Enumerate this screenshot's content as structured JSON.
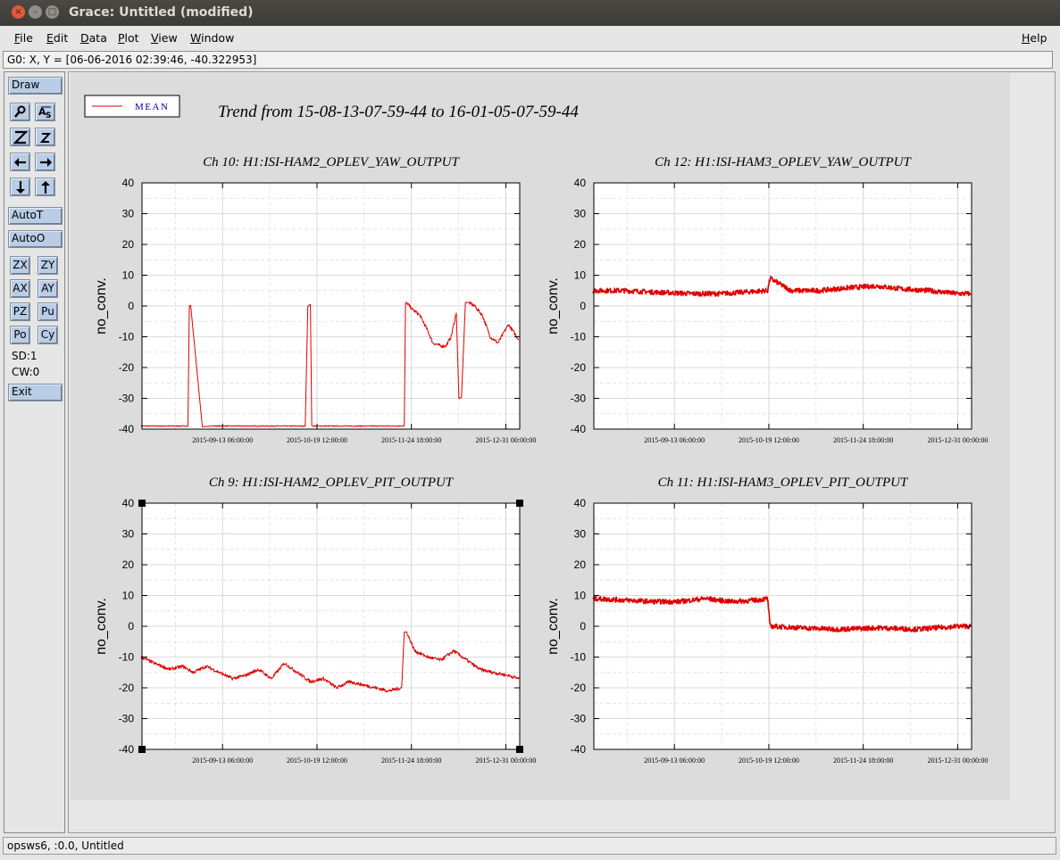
{
  "window": {
    "title": "Grace: Untitled (modified)",
    "controls": [
      "×",
      "–",
      "□"
    ]
  },
  "menubar": {
    "items": [
      {
        "label": "File",
        "mnemonic": "F",
        "rest": "ile"
      },
      {
        "label": "Edit",
        "mnemonic": "E",
        "rest": "dit"
      },
      {
        "label": "Data",
        "mnemonic": "D",
        "rest": "ata"
      },
      {
        "label": "Plot",
        "mnemonic": "P",
        "rest": "lot"
      },
      {
        "label": "View",
        "mnemonic": "V",
        "rest": "iew"
      },
      {
        "label": "Window",
        "mnemonic": "W",
        "rest": "indow"
      }
    ],
    "help": {
      "label": "Help",
      "mnemonic": "H",
      "rest": "elp"
    }
  },
  "coord_readout": "G0: X, Y = [06-06-2016 02:39:46, -40.322953]",
  "toolpanel": {
    "draw": "Draw",
    "icon_buttons": [
      {
        "name": "zoom-magnifier-icon",
        "label": ""
      },
      {
        "name": "autoscale-text-icon",
        "label": ""
      },
      {
        "name": "zoom-in-z-icon",
        "label": ""
      },
      {
        "name": "zoom-out-z-icon",
        "label": ""
      },
      {
        "name": "arrow-left-icon",
        "label": ""
      },
      {
        "name": "arrow-right-icon",
        "label": ""
      },
      {
        "name": "arrow-down-icon",
        "label": ""
      },
      {
        "name": "arrow-up-icon",
        "label": ""
      }
    ],
    "autot": "AutoT",
    "autoo": "AutoO",
    "small_buttons": [
      "ZX",
      "ZY",
      "AX",
      "AY",
      "PZ",
      "Pu",
      "Po",
      "Cy"
    ],
    "sd": "SD:1",
    "cw": "CW:0",
    "exit": "Exit"
  },
  "status_text": "opsws6, :0.0, Untitled",
  "colors": {
    "series": "#e00000",
    "legend_text": "#0000aa",
    "button_face": "#b9cde6"
  },
  "figure": {
    "title": "Trend from 15-08-13-07-59-44 to 16-01-05-07-59-44",
    "legend": {
      "label": "MEAN",
      "placement": "top-left"
    }
  },
  "chart_data": [
    {
      "type": "line",
      "title": "Ch 10: H1:ISI-HAM2_OPLEV_YAW_OUTPUT",
      "ylabel": "no_conv.",
      "xlabel": "",
      "ylim": [
        -40,
        40
      ],
      "xlim": [
        "2015-08-13 07:59:44",
        "2016-01-05 07:59:44"
      ],
      "yticks": [
        -40,
        -30,
        -20,
        -10,
        0,
        10,
        20,
        30,
        40
      ],
      "xticks": [
        "2015-09-13 06:00:00",
        "2015-10-19 12:00:00",
        "2015-11-24 18:00:00",
        "2015-12-31 00:00:00"
      ],
      "grid": true,
      "series": [
        {
          "name": "MEAN",
          "x": [
            "2015-08-13",
            "2015-08-20",
            "2015-08-27",
            "2015-08-31",
            "2015-09-01",
            "2015-09-10",
            "2015-09-20",
            "2015-10-01",
            "2015-10-15",
            "2015-10-17",
            "2015-10-18",
            "2015-10-25",
            "2015-11-10",
            "2015-11-22",
            "2015-11-23",
            "2015-11-25",
            "2015-11-28",
            "2015-12-01",
            "2015-12-03",
            "2015-12-06",
            "2015-12-08",
            "2015-12-10",
            "2015-12-12",
            "2015-12-14",
            "2015-12-17",
            "2015-12-19",
            "2015-12-22",
            "2015-12-25",
            "2015-12-28",
            "2016-01-01",
            "2016-01-05"
          ],
          "values": [
            -39,
            -39,
            -39,
            -39,
            0,
            -39,
            -39,
            -39,
            -39,
            0,
            -39,
            -39,
            -39,
            -39,
            1,
            -1,
            -3,
            -8,
            -12,
            -13,
            -13,
            -10,
            -2,
            -30,
            1,
            0,
            -3,
            -10,
            -12,
            -6,
            -11
          ]
        }
      ]
    },
    {
      "type": "line",
      "title": "Ch 12: H1:ISI-HAM3_OPLEV_YAW_OUTPUT",
      "ylabel": "no_conv.",
      "xlabel": "",
      "ylim": [
        -40,
        40
      ],
      "xlim": [
        "2015-08-13 07:59:44",
        "2016-01-05 07:59:44"
      ],
      "yticks": [
        -40,
        -30,
        -20,
        -10,
        0,
        10,
        20,
        30,
        40
      ],
      "xticks": [
        "2015-09-13 06:00:00",
        "2015-10-19 12:00:00",
        "2015-11-24 18:00:00",
        "2015-12-31 00:00:00"
      ],
      "grid": true,
      "series": [
        {
          "name": "MEAN",
          "x": [
            "2015-08-13",
            "2015-08-25",
            "2015-09-05",
            "2015-09-20",
            "2015-10-01",
            "2015-10-10",
            "2015-10-19",
            "2015-10-20",
            "2015-10-28",
            "2015-11-08",
            "2015-11-20",
            "2015-11-30",
            "2015-12-10",
            "2015-12-20",
            "2015-12-31",
            "2016-01-05"
          ],
          "values": [
            5,
            5,
            4.5,
            4,
            4,
            4.5,
            5,
            9,
            5,
            5,
            6,
            6.5,
            5.5,
            5,
            4,
            4
          ]
        }
      ]
    },
    {
      "type": "line",
      "title": "Ch 9: H1:ISI-HAM2_OPLEV_PIT_OUTPUT",
      "ylabel": "no_conv.",
      "xlabel": "",
      "ylim": [
        -40,
        40
      ],
      "xlim": [
        "2015-08-13 07:59:44",
        "2016-01-05 07:59:44"
      ],
      "yticks": [
        -40,
        -30,
        -20,
        -10,
        0,
        10,
        20,
        30,
        40
      ],
      "xticks": [
        "2015-09-13 06:00:00",
        "2015-10-19 12:00:00",
        "2015-11-24 18:00:00",
        "2015-12-31 00:00:00"
      ],
      "grid": true,
      "series": [
        {
          "name": "MEAN",
          "x": [
            "2015-08-13",
            "2015-08-18",
            "2015-08-24",
            "2015-08-29",
            "2015-09-02",
            "2015-09-07",
            "2015-09-12",
            "2015-09-17",
            "2015-09-22",
            "2015-09-27",
            "2015-10-02",
            "2015-10-07",
            "2015-10-12",
            "2015-10-17",
            "2015-10-22",
            "2015-10-27",
            "2015-11-01",
            "2015-11-06",
            "2015-11-11",
            "2015-11-16",
            "2015-11-21",
            "2015-11-23",
            "2015-11-26",
            "2015-12-01",
            "2015-12-06",
            "2015-12-11",
            "2015-12-16",
            "2015-12-21",
            "2015-12-26",
            "2016-01-01",
            "2016-01-05"
          ],
          "values": [
            -10,
            -12,
            -14,
            -13,
            -15,
            -13,
            -15,
            -17,
            -16,
            -14,
            -17,
            -12,
            -15,
            -18,
            -17,
            -20,
            -18,
            -19,
            -20,
            -21,
            -20,
            -2,
            -8,
            -10,
            -11,
            -8,
            -11,
            -14,
            -15,
            -16,
            -17
          ]
        }
      ]
    },
    {
      "type": "line",
      "title": "Ch 11: H1:ISI-HAM3_OPLEV_PIT_OUTPUT",
      "ylabel": "no_conv.",
      "xlabel": "",
      "ylim": [
        -40,
        40
      ],
      "xlim": [
        "2015-08-13 07:59:44",
        "2016-01-05 07:59:44"
      ],
      "yticks": [
        -40,
        -30,
        -20,
        -10,
        0,
        10,
        20,
        30,
        40
      ],
      "xticks": [
        "2015-09-13 06:00:00",
        "2015-10-19 12:00:00",
        "2015-11-24 18:00:00",
        "2015-12-31 00:00:00"
      ],
      "grid": true,
      "series": [
        {
          "name": "MEAN",
          "x": [
            "2015-08-13",
            "2015-08-25",
            "2015-09-05",
            "2015-09-15",
            "2015-09-25",
            "2015-10-05",
            "2015-10-15",
            "2015-10-19",
            "2015-10-20",
            "2015-11-01",
            "2015-11-15",
            "2015-12-01",
            "2015-12-15",
            "2015-12-31",
            "2016-01-05"
          ],
          "values": [
            9,
            8.5,
            8,
            8,
            9,
            8,
            8.5,
            9,
            0,
            -0.5,
            -1,
            -0.5,
            -1,
            0,
            0
          ]
        }
      ]
    }
  ]
}
